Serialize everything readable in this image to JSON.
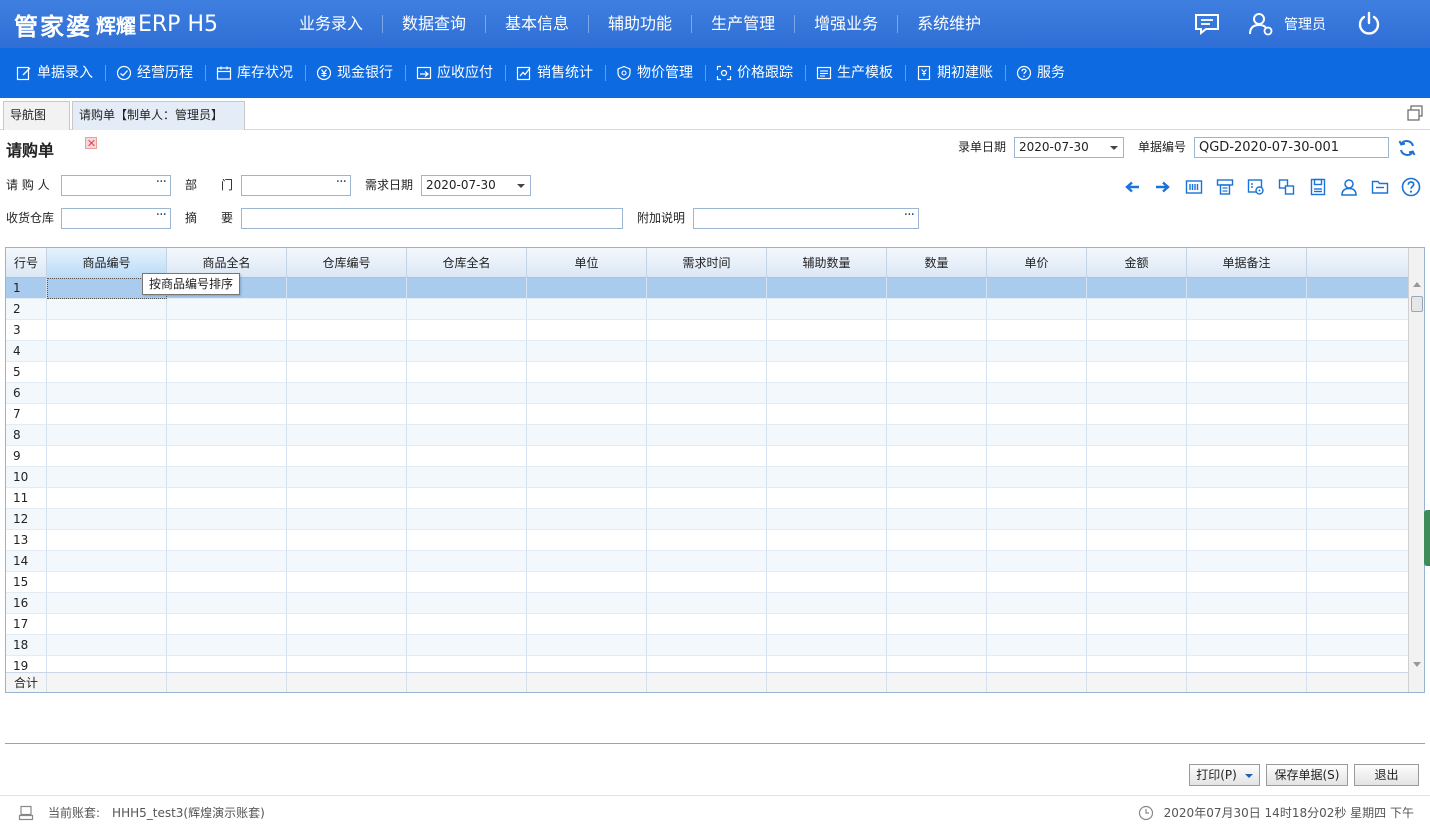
{
  "header": {
    "brand": "管家婆",
    "brand_sub": "辉耀",
    "brand_erp": "ERP H5",
    "nav": [
      "业务录入",
      "数据查询",
      "基本信息",
      "辅助功能",
      "生产管理",
      "增强业务",
      "系统维护"
    ],
    "user": "管理员"
  },
  "subnav": [
    {
      "label": "单据录入",
      "icon": "edit-icon"
    },
    {
      "label": "经营历程",
      "icon": "check-circle-icon"
    },
    {
      "label": "库存状况",
      "icon": "calendar-icon"
    },
    {
      "label": "现金银行",
      "icon": "yuan-icon"
    },
    {
      "label": "应收应付",
      "icon": "receivable-icon"
    },
    {
      "label": "销售统计",
      "icon": "stats-icon"
    },
    {
      "label": "物价管理",
      "icon": "shield-icon"
    },
    {
      "label": "价格跟踪",
      "icon": "track-icon"
    },
    {
      "label": "生产模板",
      "icon": "template-icon"
    },
    {
      "label": "期初建账",
      "icon": "ledger-icon"
    },
    {
      "label": "服务",
      "icon": "help-icon"
    }
  ],
  "tabs": [
    {
      "label": "导航图"
    },
    {
      "label": "请购单【制单人：管理员】"
    }
  ],
  "form": {
    "title": "请购单",
    "entry_date_label": "录单日期",
    "entry_date_value": "2020-07-30",
    "doc_no_label": "单据编号",
    "doc_no_value": "QGD-2020-07-30-001",
    "requester_label": "请 购 人",
    "requester_value": "",
    "dept_label": "部　　门",
    "dept_value": "",
    "need_date_label": "需求日期",
    "need_date_value": "2020-07-30",
    "warehouse_label": "收货仓库",
    "warehouse_value": "",
    "summary_label": "摘　　要",
    "summary_value": "",
    "note_label": "附加说明",
    "note_value": "",
    "ellipsis": "···"
  },
  "toolbar_icons": [
    "arrow-left-icon",
    "arrow-right-icon",
    "barcode-icon",
    "print-icon",
    "settings-grid-icon",
    "copy-icon",
    "save-doc-icon",
    "person-icon",
    "folder-icon",
    "help-circle-icon"
  ],
  "grid": {
    "columns": [
      "行号",
      "商品编号",
      "商品全名",
      "仓库编号",
      "仓库全名",
      "单位",
      "需求时间",
      "辅助数量",
      "数量",
      "单价",
      "金额",
      "单据备注"
    ],
    "rows": [
      "1",
      "2",
      "3",
      "4",
      "5",
      "6",
      "7",
      "8",
      "9",
      "10",
      "11",
      "12",
      "13",
      "14",
      "15",
      "16",
      "17",
      "18",
      "19"
    ],
    "footer_label": "合计",
    "tooltip": "按商品编号排序"
  },
  "buttons": {
    "print": "打印(P)",
    "save": "保存单据(S)",
    "exit": "退出"
  },
  "status": {
    "account_label": "当前账套:",
    "account_value": "HHH5_test3(辉煌演示账套)",
    "datetime": "2020年07月30日 14时18分02秒 星期四 下午"
  },
  "colors": {
    "header_blue": "#2f6fd6",
    "subnav_blue": "#0d6ae0",
    "icon_blue": "#1a73d9"
  }
}
